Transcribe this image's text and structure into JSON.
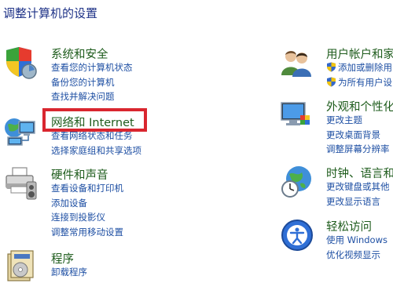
{
  "page": {
    "title": "调整计算机的设置"
  },
  "left_categories": [
    {
      "title": "系统和安全",
      "icon": "shield-icon",
      "links": [
        "查看您的计算机状态",
        "备份您的计算机",
        "查找并解决问题"
      ]
    },
    {
      "title": "网络和 Internet",
      "icon": "network-icon",
      "links": [
        "查看网络状态和任务",
        "选择家庭组和共享选项"
      ]
    },
    {
      "title": "硬件和声音",
      "icon": "printer-icon",
      "links": [
        "查看设备和打印机",
        "添加设备",
        "连接到投影仪",
        "调整常用移动设置"
      ]
    },
    {
      "title": "程序",
      "icon": "programs-icon",
      "links": [
        "卸载程序"
      ]
    }
  ],
  "right_categories": [
    {
      "title": "用户帐户和家",
      "icon": "users-icon",
      "links": [
        "添加或删除用",
        "为所有用户设"
      ]
    },
    {
      "title": "外观和个性化",
      "icon": "appearance-icon",
      "links": [
        "更改主题",
        "更改桌面背景",
        "调整屏幕分辨率"
      ]
    },
    {
      "title": "时钟、语言和",
      "icon": "clock-globe-icon",
      "links": [
        "更改键盘或其他",
        "更改显示语言"
      ]
    },
    {
      "title": "轻松访问",
      "icon": "accessibility-icon",
      "links": [
        "使用 Windows",
        "优化视频显示"
      ]
    }
  ],
  "colors": {
    "category_title": "#1e5c1c",
    "link": "#1e4fa3",
    "highlight": "#d9262f",
    "page_title": "#1e3287"
  }
}
